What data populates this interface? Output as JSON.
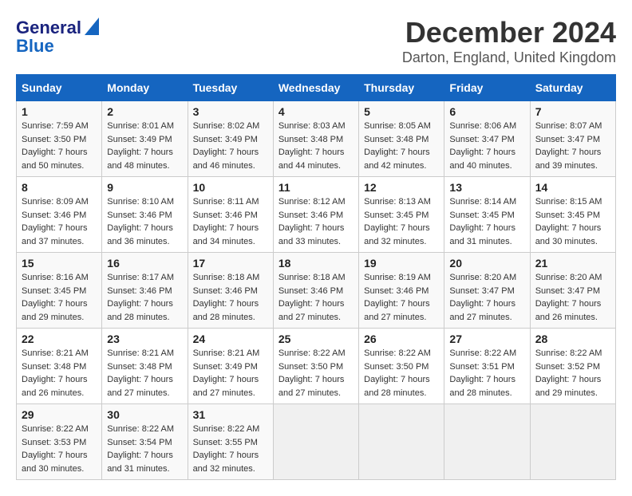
{
  "logo": {
    "line1": "General",
    "line2": "Blue"
  },
  "title": "December 2024",
  "subtitle": "Darton, England, United Kingdom",
  "days": [
    "Sunday",
    "Monday",
    "Tuesday",
    "Wednesday",
    "Thursday",
    "Friday",
    "Saturday"
  ],
  "weeks": [
    [
      {
        "day": 1,
        "sunrise": "Sunrise: 7:59 AM",
        "sunset": "Sunset: 3:50 PM",
        "daylight": "Daylight: 7 hours and 50 minutes."
      },
      {
        "day": 2,
        "sunrise": "Sunrise: 8:01 AM",
        "sunset": "Sunset: 3:49 PM",
        "daylight": "Daylight: 7 hours and 48 minutes."
      },
      {
        "day": 3,
        "sunrise": "Sunrise: 8:02 AM",
        "sunset": "Sunset: 3:49 PM",
        "daylight": "Daylight: 7 hours and 46 minutes."
      },
      {
        "day": 4,
        "sunrise": "Sunrise: 8:03 AM",
        "sunset": "Sunset: 3:48 PM",
        "daylight": "Daylight: 7 hours and 44 minutes."
      },
      {
        "day": 5,
        "sunrise": "Sunrise: 8:05 AM",
        "sunset": "Sunset: 3:48 PM",
        "daylight": "Daylight: 7 hours and 42 minutes."
      },
      {
        "day": 6,
        "sunrise": "Sunrise: 8:06 AM",
        "sunset": "Sunset: 3:47 PM",
        "daylight": "Daylight: 7 hours and 40 minutes."
      },
      {
        "day": 7,
        "sunrise": "Sunrise: 8:07 AM",
        "sunset": "Sunset: 3:47 PM",
        "daylight": "Daylight: 7 hours and 39 minutes."
      }
    ],
    [
      {
        "day": 8,
        "sunrise": "Sunrise: 8:09 AM",
        "sunset": "Sunset: 3:46 PM",
        "daylight": "Daylight: 7 hours and 37 minutes."
      },
      {
        "day": 9,
        "sunrise": "Sunrise: 8:10 AM",
        "sunset": "Sunset: 3:46 PM",
        "daylight": "Daylight: 7 hours and 36 minutes."
      },
      {
        "day": 10,
        "sunrise": "Sunrise: 8:11 AM",
        "sunset": "Sunset: 3:46 PM",
        "daylight": "Daylight: 7 hours and 34 minutes."
      },
      {
        "day": 11,
        "sunrise": "Sunrise: 8:12 AM",
        "sunset": "Sunset: 3:46 PM",
        "daylight": "Daylight: 7 hours and 33 minutes."
      },
      {
        "day": 12,
        "sunrise": "Sunrise: 8:13 AM",
        "sunset": "Sunset: 3:45 PM",
        "daylight": "Daylight: 7 hours and 32 minutes."
      },
      {
        "day": 13,
        "sunrise": "Sunrise: 8:14 AM",
        "sunset": "Sunset: 3:45 PM",
        "daylight": "Daylight: 7 hours and 31 minutes."
      },
      {
        "day": 14,
        "sunrise": "Sunrise: 8:15 AM",
        "sunset": "Sunset: 3:45 PM",
        "daylight": "Daylight: 7 hours and 30 minutes."
      }
    ],
    [
      {
        "day": 15,
        "sunrise": "Sunrise: 8:16 AM",
        "sunset": "Sunset: 3:45 PM",
        "daylight": "Daylight: 7 hours and 29 minutes."
      },
      {
        "day": 16,
        "sunrise": "Sunrise: 8:17 AM",
        "sunset": "Sunset: 3:46 PM",
        "daylight": "Daylight: 7 hours and 28 minutes."
      },
      {
        "day": 17,
        "sunrise": "Sunrise: 8:18 AM",
        "sunset": "Sunset: 3:46 PM",
        "daylight": "Daylight: 7 hours and 28 minutes."
      },
      {
        "day": 18,
        "sunrise": "Sunrise: 8:18 AM",
        "sunset": "Sunset: 3:46 PM",
        "daylight": "Daylight: 7 hours and 27 minutes."
      },
      {
        "day": 19,
        "sunrise": "Sunrise: 8:19 AM",
        "sunset": "Sunset: 3:46 PM",
        "daylight": "Daylight: 7 hours and 27 minutes."
      },
      {
        "day": 20,
        "sunrise": "Sunrise: 8:20 AM",
        "sunset": "Sunset: 3:47 PM",
        "daylight": "Daylight: 7 hours and 27 minutes."
      },
      {
        "day": 21,
        "sunrise": "Sunrise: 8:20 AM",
        "sunset": "Sunset: 3:47 PM",
        "daylight": "Daylight: 7 hours and 26 minutes."
      }
    ],
    [
      {
        "day": 22,
        "sunrise": "Sunrise: 8:21 AM",
        "sunset": "Sunset: 3:48 PM",
        "daylight": "Daylight: 7 hours and 26 minutes."
      },
      {
        "day": 23,
        "sunrise": "Sunrise: 8:21 AM",
        "sunset": "Sunset: 3:48 PM",
        "daylight": "Daylight: 7 hours and 27 minutes."
      },
      {
        "day": 24,
        "sunrise": "Sunrise: 8:21 AM",
        "sunset": "Sunset: 3:49 PM",
        "daylight": "Daylight: 7 hours and 27 minutes."
      },
      {
        "day": 25,
        "sunrise": "Sunrise: 8:22 AM",
        "sunset": "Sunset: 3:50 PM",
        "daylight": "Daylight: 7 hours and 27 minutes."
      },
      {
        "day": 26,
        "sunrise": "Sunrise: 8:22 AM",
        "sunset": "Sunset: 3:50 PM",
        "daylight": "Daylight: 7 hours and 28 minutes."
      },
      {
        "day": 27,
        "sunrise": "Sunrise: 8:22 AM",
        "sunset": "Sunset: 3:51 PM",
        "daylight": "Daylight: 7 hours and 28 minutes."
      },
      {
        "day": 28,
        "sunrise": "Sunrise: 8:22 AM",
        "sunset": "Sunset: 3:52 PM",
        "daylight": "Daylight: 7 hours and 29 minutes."
      }
    ],
    [
      {
        "day": 29,
        "sunrise": "Sunrise: 8:22 AM",
        "sunset": "Sunset: 3:53 PM",
        "daylight": "Daylight: 7 hours and 30 minutes."
      },
      {
        "day": 30,
        "sunrise": "Sunrise: 8:22 AM",
        "sunset": "Sunset: 3:54 PM",
        "daylight": "Daylight: 7 hours and 31 minutes."
      },
      {
        "day": 31,
        "sunrise": "Sunrise: 8:22 AM",
        "sunset": "Sunset: 3:55 PM",
        "daylight": "Daylight: 7 hours and 32 minutes."
      },
      null,
      null,
      null,
      null
    ]
  ]
}
